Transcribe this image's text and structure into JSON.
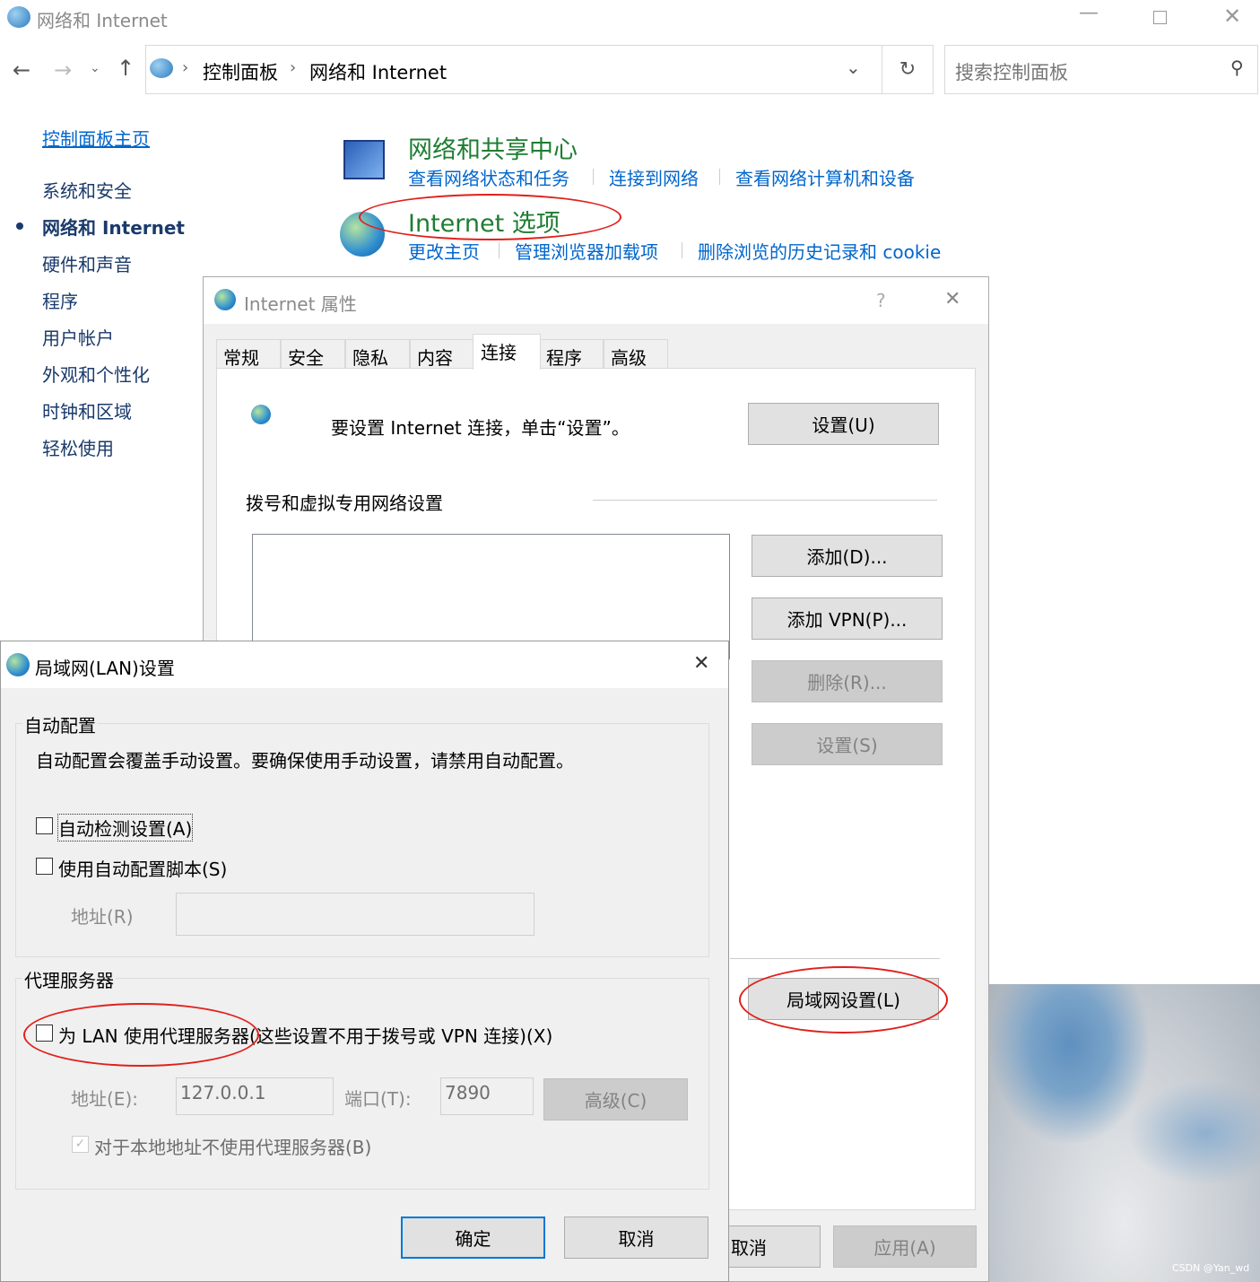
{
  "window": {
    "title": "网络和 Internet",
    "controls": [
      "minimize",
      "maximize",
      "close"
    ]
  },
  "nav": {
    "breadcrumb": [
      "控制面板",
      "网络和 Internet"
    ],
    "search_placeholder": "搜索控制面板"
  },
  "sidebar": {
    "home": "控制面板主页",
    "items": [
      {
        "label": "系统和安全"
      },
      {
        "label": "网络和 Internet",
        "active": true
      },
      {
        "label": "硬件和声音"
      },
      {
        "label": "程序"
      },
      {
        "label": "用户帐户"
      },
      {
        "label": "外观和个性化"
      },
      {
        "label": "时钟和区域"
      },
      {
        "label": "轻松使用"
      }
    ]
  },
  "sections": [
    {
      "title": "网络和共享中心",
      "links": [
        "查看网络状态和任务",
        "连接到网络",
        "查看网络计算机和设备"
      ]
    },
    {
      "title": "Internet 选项",
      "links": [
        "更改主页",
        "管理浏览器加载项",
        "删除浏览的历史记录和 cookie"
      ]
    }
  ],
  "props": {
    "title": "Internet 属性",
    "help": "?",
    "tabs": [
      "常规",
      "安全",
      "隐私",
      "内容",
      "连接",
      "程序",
      "高级"
    ],
    "active_tab": "连接",
    "setup_text": "要设置 Internet 连接，单击“设置”。",
    "setup_btn": "设置(U)",
    "dialup_label": "拨号和虚拟专用网络设置",
    "add_btn": "添加(D)...",
    "add_vpn_btn": "添加 VPN(P)...",
    "remove_btn": "删除(R)...",
    "settings_btn": "设置(S)",
    "lan_btn": "局域网设置(L)",
    "cancel_btn": "取消",
    "apply_btn": "应用(A)"
  },
  "lan": {
    "title": "局域网(LAN)设置",
    "auto_group": "自动配置",
    "auto_desc": "自动配置会覆盖手动设置。要确保使用手动设置，请禁用自动配置。",
    "auto_detect": "自动检测设置(A)",
    "auto_detect_checked": false,
    "use_script": "使用自动配置脚本(S)",
    "use_script_checked": false,
    "script_addr_label": "地址(R)",
    "script_addr_value": "",
    "proxy_group": "代理服务器",
    "use_proxy": "为 LAN 使用代理服务器(这些设置不用于拨号或 VPN 连接)(X)",
    "use_proxy_checked": false,
    "addr_label": "地址(E):",
    "addr_value": "127.0.0.1",
    "port_label": "端口(T):",
    "port_value": "7890",
    "advanced_btn": "高级(C)",
    "bypass_local": "对于本地地址不使用代理服务器(B)",
    "bypass_local_checked": true,
    "ok_btn": "确定",
    "cancel_btn": "取消"
  },
  "watermark": "CSDN @Yan_wd",
  "colors": {
    "link": "#0066cc",
    "heading": "#1e7d32",
    "annotation": "#e0201b",
    "accent": "#0078d7"
  }
}
